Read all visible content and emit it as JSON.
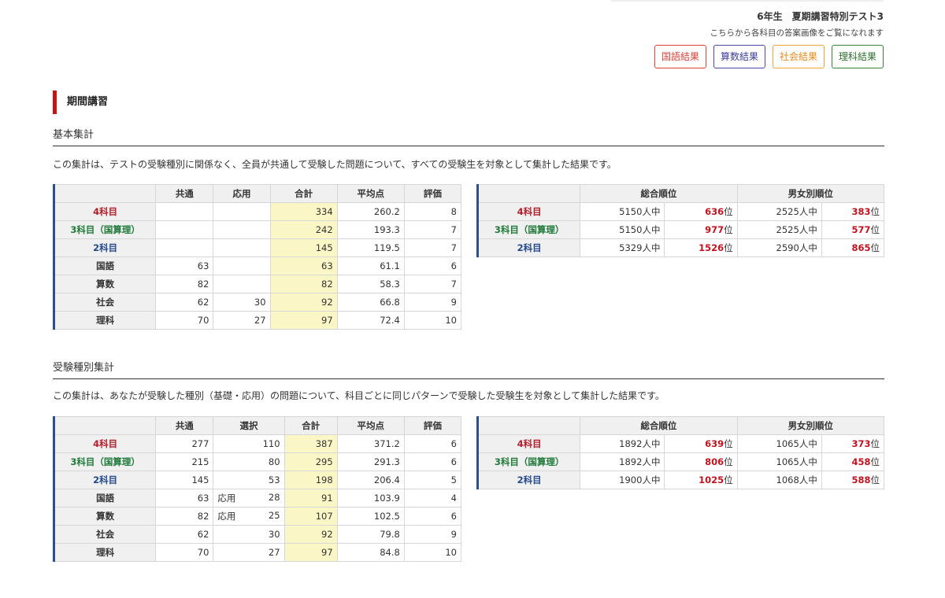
{
  "header": {
    "exam_title": "6年生　夏期講習特別テスト3",
    "note": "こちらから各科目の答案画像をご覧になれます",
    "buttons": {
      "japanese": "国語結果",
      "math": "算数結果",
      "social": "社会結果",
      "science": "理科結果"
    }
  },
  "section_title": "期間講習",
  "basic": {
    "heading": "基本集計",
    "description": "この集計は、テストの受験種別に関係なく、全員が共通して受験した問題について、すべての受験生を対象として集計した結果です。",
    "score_headers": [
      "共通",
      "応用",
      "合計",
      "平均点",
      "評価"
    ],
    "scores": [
      {
        "label": "4科目",
        "common": "",
        "applied": "",
        "total": "334",
        "avg": "260.2",
        "grade": "8"
      },
      {
        "label": "3科目（国算理）",
        "common": "",
        "applied": "",
        "total": "242",
        "avg": "193.3",
        "grade": "7"
      },
      {
        "label": "2科目",
        "common": "",
        "applied": "",
        "total": "145",
        "avg": "119.5",
        "grade": "7"
      },
      {
        "label": "国語",
        "common": "63",
        "applied": "",
        "total": "63",
        "avg": "61.1",
        "grade": "6"
      },
      {
        "label": "算数",
        "common": "82",
        "applied": "",
        "total": "82",
        "avg": "58.3",
        "grade": "7"
      },
      {
        "label": "社会",
        "common": "62",
        "applied": "30",
        "total": "92",
        "avg": "66.8",
        "grade": "9"
      },
      {
        "label": "理科",
        "common": "70",
        "applied": "27",
        "total": "97",
        "avg": "72.4",
        "grade": "10"
      }
    ],
    "rank_headers": [
      "総合順位",
      "男女別順位"
    ],
    "ranks": [
      {
        "label": "4科目",
        "total_count": "5150人中",
        "total_rank": "636",
        "gender_count": "2525人中",
        "gender_rank": "383"
      },
      {
        "label": "3科目（国算理）",
        "total_count": "5150人中",
        "total_rank": "977",
        "gender_count": "2525人中",
        "gender_rank": "577"
      },
      {
        "label": "2科目",
        "total_count": "5329人中",
        "total_rank": "1526",
        "gender_count": "2590人中",
        "gender_rank": "865"
      }
    ]
  },
  "type_based": {
    "heading": "受験種別集計",
    "description": "この集計は、あなたが受験した種別（基礎・応用）の問題について、科目ごとに同じパターンで受験した受験生を対象として集計した結果です。",
    "score_headers": [
      "共通",
      "選択",
      "合計",
      "平均点",
      "評価"
    ],
    "scores": [
      {
        "label": "4科目",
        "common": "277",
        "choice_tag": "",
        "choice": "110",
        "total": "387",
        "avg": "371.2",
        "grade": "6"
      },
      {
        "label": "3科目（国算理）",
        "common": "215",
        "choice_tag": "",
        "choice": "80",
        "total": "295",
        "avg": "291.3",
        "grade": "6"
      },
      {
        "label": "2科目",
        "common": "145",
        "choice_tag": "",
        "choice": "53",
        "total": "198",
        "avg": "206.4",
        "grade": "5"
      },
      {
        "label": "国語",
        "common": "63",
        "choice_tag": "応用",
        "choice": "28",
        "total": "91",
        "avg": "103.9",
        "grade": "4"
      },
      {
        "label": "算数",
        "common": "82",
        "choice_tag": "応用",
        "choice": "25",
        "total": "107",
        "avg": "102.5",
        "grade": "6"
      },
      {
        "label": "社会",
        "common": "62",
        "choice_tag": "",
        "choice": "30",
        "total": "92",
        "avg": "79.8",
        "grade": "9"
      },
      {
        "label": "理科",
        "common": "70",
        "choice_tag": "",
        "choice": "27",
        "total": "97",
        "avg": "84.8",
        "grade": "10"
      }
    ],
    "rank_headers": [
      "総合順位",
      "男女別順位"
    ],
    "ranks": [
      {
        "label": "4科目",
        "total_count": "1892人中",
        "total_rank": "639",
        "gender_count": "1065人中",
        "gender_rank": "373"
      },
      {
        "label": "3科目（国算理）",
        "total_count": "1892人中",
        "total_rank": "806",
        "gender_count": "1065人中",
        "gender_rank": "458"
      },
      {
        "label": "2科目",
        "total_count": "1900人中",
        "total_rank": "1025",
        "gender_count": "1068人中",
        "gender_rank": "588"
      }
    ]
  },
  "rank_unit": "位"
}
